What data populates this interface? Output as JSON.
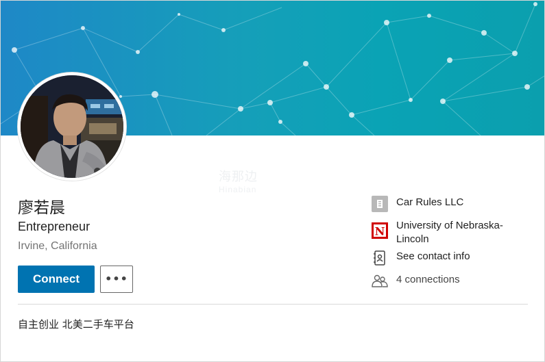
{
  "profile": {
    "name": "廖若晨",
    "headline": "Entrepreneur",
    "location": "Irvine, California",
    "summary": "自主创业 北美二手车平台"
  },
  "actions": {
    "connect_label": "Connect",
    "more_label": "•••"
  },
  "sidebar": {
    "company": {
      "label": "Car Rules LLC",
      "icon": "building-icon"
    },
    "school": {
      "label": "University of Nebraska-Lincoln",
      "icon": "university-logo",
      "logo_letter": "N"
    },
    "contact": {
      "label": "See contact info",
      "icon": "contact-card-icon"
    },
    "connections": {
      "label": "4 connections",
      "icon": "people-icon"
    }
  },
  "watermark": {
    "text": "海那边",
    "subtext": "Hinabian"
  },
  "colors": {
    "primary": "#0073b1",
    "banner_start": "#1e88c7",
    "banner_end": "#0b9fae",
    "school_red": "#d00000"
  }
}
